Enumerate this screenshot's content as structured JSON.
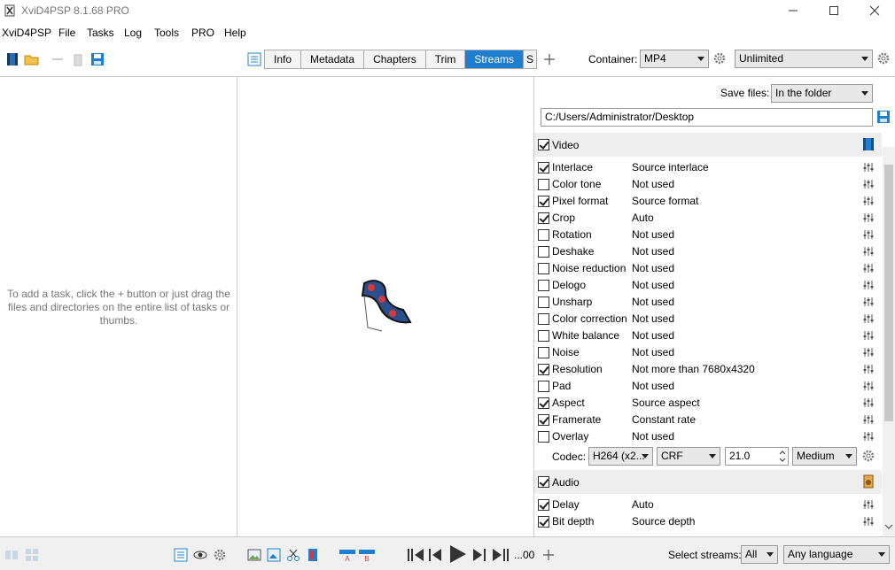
{
  "window": {
    "title": "XviD4PSP 8.1.68 PRO"
  },
  "menu": [
    "XviD4PSP",
    "File",
    "Tasks",
    "Log",
    "Tools",
    "PRO",
    "Help"
  ],
  "tabs": [
    "Info",
    "Metadata",
    "Chapters",
    "Trim",
    "Streams",
    "S"
  ],
  "active_tab": "Streams",
  "container": {
    "label": "Container:",
    "value": "MP4",
    "size_value": "Unlimited"
  },
  "save": {
    "label": "Save files:",
    "value": "In the folder",
    "path": "C:/Users/Administrator/Desktop"
  },
  "task_hint": "To add a task, click the + button or just drag the files and directories on the entire list of tasks or thumbs.",
  "video": {
    "header": "Video",
    "checked": true,
    "rows": [
      {
        "label": "Interlace",
        "value": "Source interlace",
        "checked": true
      },
      {
        "label": "Color tone",
        "value": "Not used",
        "checked": false
      },
      {
        "label": "Pixel format",
        "value": "Source format",
        "checked": true
      },
      {
        "label": "Crop",
        "value": "Auto",
        "checked": true
      },
      {
        "label": "Rotation",
        "value": "Not used",
        "checked": false
      },
      {
        "label": "Deshake",
        "value": "Not used",
        "checked": false
      },
      {
        "label": "Noise reduction",
        "value": "Not used",
        "checked": false
      },
      {
        "label": "Delogo",
        "value": "Not used",
        "checked": false
      },
      {
        "label": "Unsharp",
        "value": "Not used",
        "checked": false
      },
      {
        "label": "Color correction",
        "value": "Not used",
        "checked": false
      },
      {
        "label": "White balance",
        "value": "Not used",
        "checked": false
      },
      {
        "label": "Noise",
        "value": "Not used",
        "checked": false
      },
      {
        "label": "Resolution",
        "value": "Not more than 7680x4320",
        "checked": true
      },
      {
        "label": "Pad",
        "value": "Not used",
        "checked": false
      },
      {
        "label": "Aspect",
        "value": "Source aspect",
        "checked": true
      },
      {
        "label": "Framerate",
        "value": "Constant rate",
        "checked": true
      },
      {
        "label": "Overlay",
        "value": "Not used",
        "checked": false
      }
    ],
    "codec": {
      "label": "Codec:",
      "value": "H264 (x2...",
      "mode": "CRF",
      "crf": "21.0",
      "preset": "Medium"
    }
  },
  "audio": {
    "header": "Audio",
    "checked": true,
    "rows": [
      {
        "label": "Delay",
        "value": "Auto",
        "checked": true
      },
      {
        "label": "Bit depth",
        "value": "Source depth",
        "checked": true
      }
    ]
  },
  "bottom": {
    "time": "...00",
    "select_streams_label": "Select streams:",
    "streams_value": "All",
    "language_value": "Any language"
  }
}
